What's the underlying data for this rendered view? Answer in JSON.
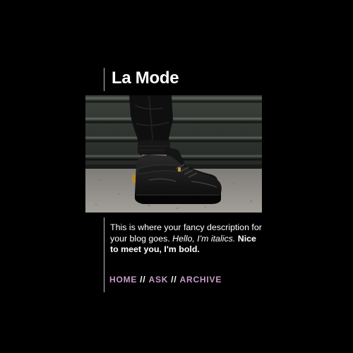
{
  "blog": {
    "title": "La Mode",
    "description": {
      "plain": "This is where your fancy description for your blog goes. ",
      "italic": "Hello, I'm italics.",
      "bold": "Nice to meet you, I'm bold."
    }
  },
  "nav": {
    "items": [
      {
        "label": "HOME"
      },
      {
        "label": "ASK"
      },
      {
        "label": "ARCHIVE"
      }
    ],
    "separator": "//"
  },
  "header_image": {
    "subject": "black leather high-top sneakers on legs in black jogger pants against a corrugated metal wall"
  },
  "colors": {
    "background": "#000000",
    "text": "#ffffff",
    "nav_link": "#c79bc7",
    "rule": "#bfbfbf"
  }
}
